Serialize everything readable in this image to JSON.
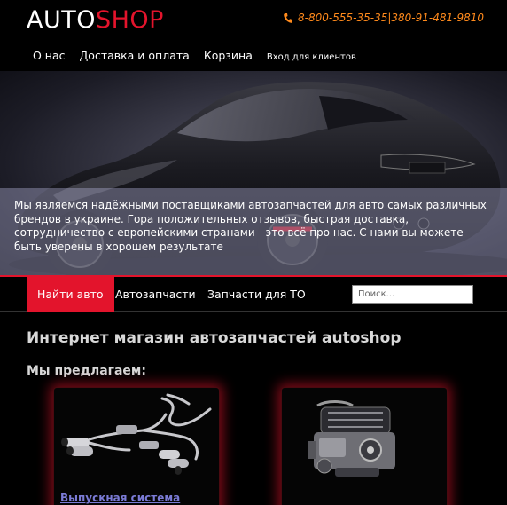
{
  "header": {
    "logo_white": "AUTO",
    "logo_red": "SHOP",
    "phone": "8-800-555-35-35|380-91-481-9810"
  },
  "topnav": {
    "items": [
      "О нас",
      "Доставка и оплата",
      "Корзина",
      "Вход для клиентов"
    ]
  },
  "hero": {
    "text": "Мы являемся надёжными поставщиками автозапчастей для авто самых различных брендов в украине. Гора положительных отзывов, быстрая доставка, сотрудничество с европейскими странами - это всё про нас. С нами вы можете быть уверены в хорошем результате"
  },
  "mainnav": {
    "items": [
      "Найти авто",
      "Автозапчасти",
      "Запчасти для ТО"
    ],
    "search_placeholder": "Поиск..."
  },
  "main": {
    "title": "Интернет магазин автозапчастей autoshop",
    "subtitle": "Мы предлагаем:",
    "products": [
      {
        "label": "Выпускная система"
      },
      {
        "label": ""
      }
    ]
  },
  "colors": {
    "accent": "#e3142c",
    "phone": "#ff8a1c",
    "link": "#7b7bd6"
  },
  "icons": {
    "phone": "phone-icon"
  }
}
